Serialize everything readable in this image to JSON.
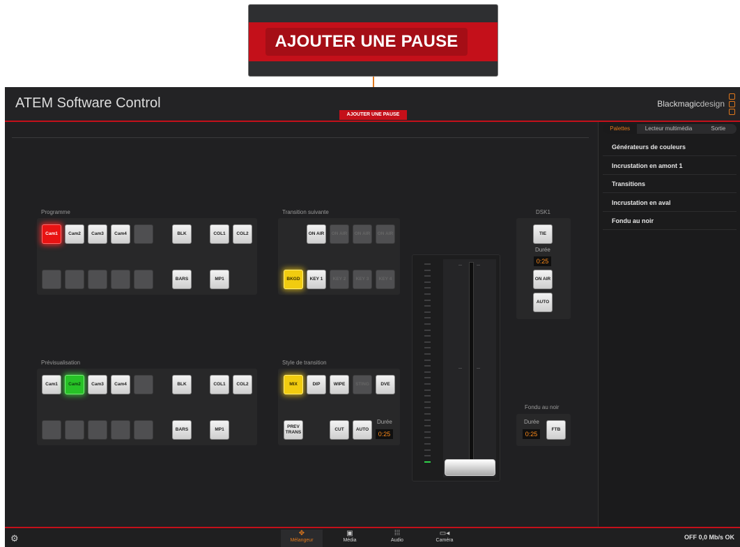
{
  "callout": {
    "label": "AJOUTER UNE PAUSE"
  },
  "app": {
    "title": "ATEM Software Control",
    "brand": {
      "main": "Blackmagic",
      "suffix": "design"
    },
    "pause_tab": "AJOUTER UNE PAUSE",
    "accent": "#c4101a",
    "orange": "#e0781c"
  },
  "program": {
    "label": "Programme",
    "row1": [
      "Cam1",
      "Cam2",
      "Cam3",
      "Cam4",
      "",
      "BLK",
      "COL1",
      "COL2"
    ],
    "row2": [
      "",
      "",
      "",
      "",
      "",
      "BARS",
      "MP1"
    ]
  },
  "preview": {
    "label": "Prévisualisation",
    "row1": [
      "Cam1",
      "Cam2",
      "Cam3",
      "Cam4",
      "",
      "BLK",
      "COL1",
      "COL2"
    ],
    "row2": [
      "",
      "",
      "",
      "",
      "",
      "BARS",
      "MP1"
    ]
  },
  "next_transition": {
    "label": "Transition suivante",
    "on_air": [
      "ON AIR",
      "ON AIR",
      "ON AIR",
      "ON AIR"
    ],
    "keys": [
      "BKGD",
      "KEY 1",
      "KEY 2",
      "KEY 3",
      "KEY 4"
    ]
  },
  "transition_style": {
    "label": "Style de transition",
    "styles": [
      "MIX",
      "DIP",
      "WIPE",
      "STING",
      "DVE"
    ],
    "prev_trans": "PREV TRANS",
    "cut": "CUT",
    "auto": "AUTO",
    "duration_label": "Durée",
    "duration": "0:25"
  },
  "dsk": {
    "label": "DSK1",
    "tie": "TIE",
    "duration_label": "Durée",
    "duration": "0:25",
    "on_air": "ON AIR",
    "auto": "AUTO"
  },
  "ftb": {
    "label": "Fondu au noir",
    "duration_label": "Durée",
    "duration": "0:25",
    "button": "FTB"
  },
  "sidebar": {
    "tabs": [
      "Palettes",
      "Lecteur multimédia",
      "Sortie"
    ],
    "items": [
      "Générateurs de couleurs",
      "Incrustation en amont 1",
      "Transitions",
      "Incrustation en aval",
      "Fondu au noir"
    ]
  },
  "bottom_nav": [
    {
      "label": "Mélangeur",
      "icon": "mixer-icon"
    },
    {
      "label": "Média",
      "icon": "media-icon"
    },
    {
      "label": "Audio",
      "icon": "audio-icon"
    },
    {
      "label": "Caméra",
      "icon": "camera-icon"
    }
  ],
  "status": "OFF 0,0 Mb/s OK"
}
